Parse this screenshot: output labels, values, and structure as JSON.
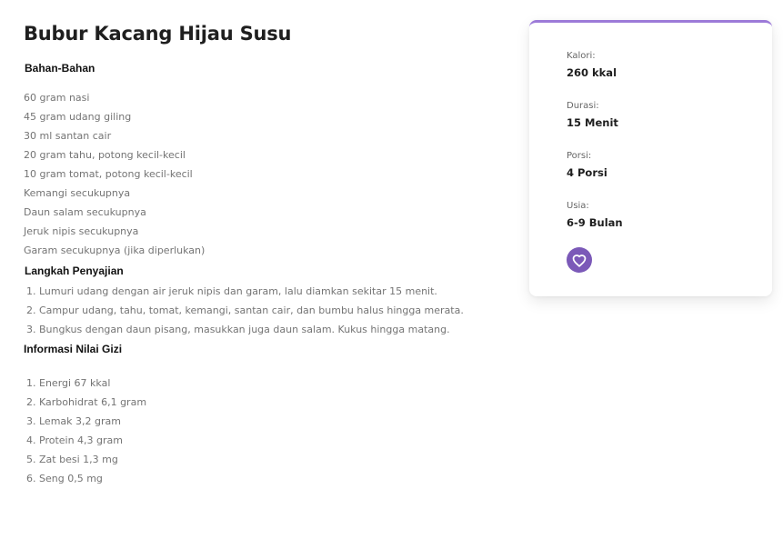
{
  "recipe": {
    "title": "Bubur Kacang Hijau Susu",
    "ingredients_heading": "Bahan-Bahan",
    "ingredients": [
      "60 gram nasi",
      "45 gram udang giling",
      "30 ml santan cair",
      "20 gram tahu, potong kecil-kecil",
      "10 gram tomat, potong kecil-kecil",
      "Kemangi secukupnya",
      "Daun salam secukupnya",
      "Jeruk nipis secukupnya",
      "Garam secukupnya (jika diperlukan)"
    ],
    "steps_heading": "Langkah Penyajian",
    "steps": [
      {
        "num": "1.",
        "text": "Lumuri udang dengan air jeruk nipis dan garam, lalu diamkan sekitar 15 menit."
      },
      {
        "num": "2.",
        "text": "Campur udang, tahu, tomat, kemangi, santan cair, dan bumbu halus hingga merata."
      },
      {
        "num": "3.",
        "text": "Bungkus dengan daun pisang, masukkan juga daun salam. Kukus hingga matang."
      }
    ],
    "nutrition_heading": "Informasi Nilai Gizi",
    "nutrition": [
      {
        "num": "1.",
        "text": "Energi 67 kkal"
      },
      {
        "num": "2.",
        "text": "Karbohidrat 6,1 gram"
      },
      {
        "num": "3.",
        "text": "Lemak 3,2 gram"
      },
      {
        "num": "4.",
        "text": "Protein 4,3 gram"
      },
      {
        "num": "5.",
        "text": "Zat besi 1,3 mg"
      },
      {
        "num": "6.",
        "text": "Seng 0,5 mg"
      }
    ]
  },
  "info_card": {
    "accent_color": "#9c7ad8",
    "stats": [
      {
        "label": "Kalori:",
        "value": "260 kkal"
      },
      {
        "label": "Durasi:",
        "value": "15 Menit"
      },
      {
        "label": "Porsi:",
        "value": "4 Porsi"
      },
      {
        "label": "Usia:",
        "value": "6-9 Bulan"
      }
    ],
    "favorite_icon": "heart-icon",
    "favorite_color": "#7b59b8"
  }
}
